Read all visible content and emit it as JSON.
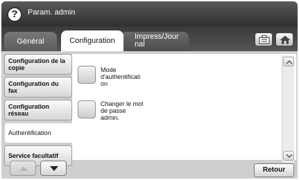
{
  "header": {
    "help_glyph": "?",
    "title": "Param. admin"
  },
  "tabs": [
    {
      "label": "Général",
      "active": false
    },
    {
      "label": "Configuration",
      "active": true
    },
    {
      "label_line1": "Impress/Jour",
      "label_line2": "nal",
      "active": false
    }
  ],
  "toolbar": {
    "icons": [
      "job-status-icon",
      "home-icon"
    ]
  },
  "sidebar": {
    "items": [
      {
        "line1": "Configuration de la",
        "line2": "copie"
      },
      {
        "line1": "Configuration du",
        "line2": "fax"
      },
      {
        "line1": "Configuration",
        "line2": "réseau"
      },
      {
        "line1": "Authentification",
        "line2": "",
        "active": true
      },
      {
        "line1": "Service facultatif",
        "line2": ""
      }
    ],
    "nav": [
      "scroll-up-icon",
      "scroll-down-icon"
    ]
  },
  "options": [
    {
      "line1": "Mode",
      "line2": "d'authentificati",
      "line3": "on"
    },
    {
      "line1": "Changer le mot",
      "line2": "de passe",
      "line3": "admin."
    }
  ],
  "footer": {
    "back_label": "Retour"
  },
  "colors": {
    "header_dark": "#2f2f2f",
    "panel_bg": "#cfcfcf",
    "active_tab": "#ffffff"
  }
}
